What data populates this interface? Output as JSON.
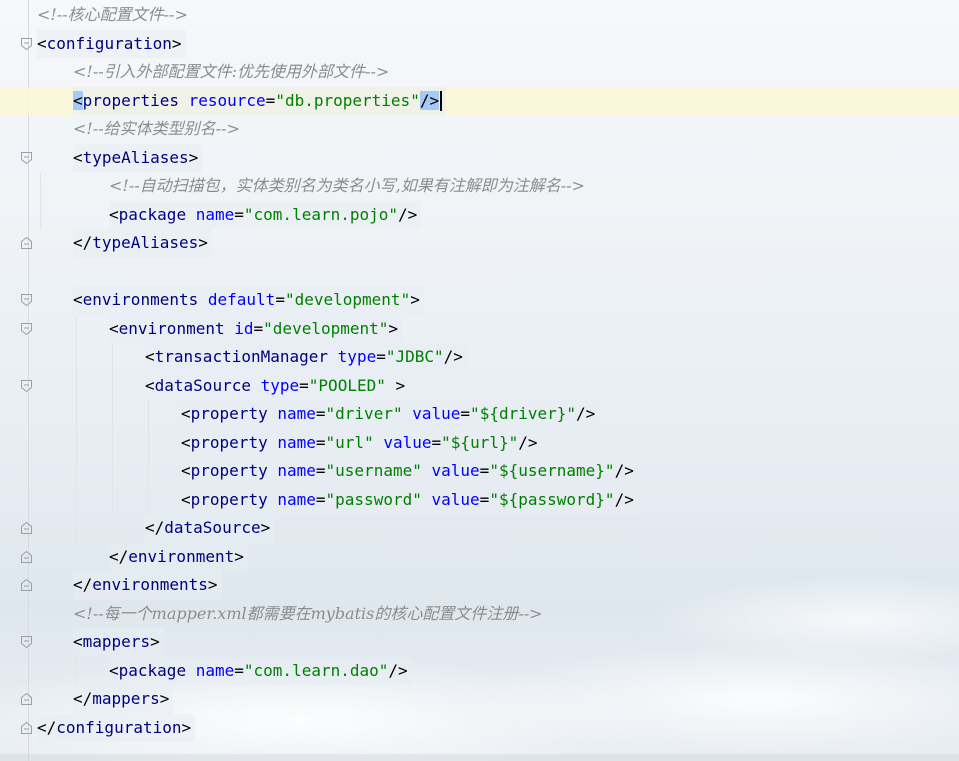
{
  "editor": {
    "lines": [
      {
        "indent": 0,
        "fold": "",
        "comment": "<!--核心配置文件-->"
      },
      {
        "indent": 0,
        "fold": "open",
        "open": "configuration"
      },
      {
        "indent": 1,
        "fold": "",
        "comment": "<!--引入外部配置文件:优先使用外部文件-->"
      },
      {
        "indent": 1,
        "fold": "",
        "current": true,
        "selfclose": "properties",
        "attrs": [
          [
            "resource",
            "db.properties"
          ]
        ]
      },
      {
        "indent": 1,
        "fold": "",
        "comment": "<!--给实体类型别名-->"
      },
      {
        "indent": 1,
        "fold": "open",
        "open": "typeAliases"
      },
      {
        "indent": 2,
        "fold": "",
        "comment": "<!--自动扫描包，实体类别名为类名小写,如果有注解即为注解名-->"
      },
      {
        "indent": 2,
        "fold": "",
        "selfclose": "package",
        "attrs": [
          [
            "name",
            "com.learn.pojo"
          ]
        ]
      },
      {
        "indent": 1,
        "fold": "close",
        "close": "typeAliases"
      },
      {
        "indent": 0,
        "fold": "",
        "blank": true
      },
      {
        "indent": 1,
        "fold": "open",
        "open": "environments",
        "attrs": [
          [
            "default",
            "development"
          ]
        ]
      },
      {
        "indent": 2,
        "fold": "open",
        "open": "environment",
        "attrs": [
          [
            "id",
            "development"
          ]
        ]
      },
      {
        "indent": 3,
        "fold": "",
        "selfclose": "transactionManager",
        "attrs": [
          [
            "type",
            "JDBC"
          ]
        ]
      },
      {
        "indent": 3,
        "fold": "open",
        "open": "dataSource",
        "attrs": [
          [
            "type",
            "POOLED"
          ]
        ],
        "trail": " "
      },
      {
        "indent": 4,
        "fold": "",
        "selfclose": "property",
        "attrs": [
          [
            "name",
            "driver"
          ],
          [
            "value",
            "${driver}"
          ]
        ]
      },
      {
        "indent": 4,
        "fold": "",
        "selfclose": "property",
        "attrs": [
          [
            "name",
            "url"
          ],
          [
            "value",
            "${url}"
          ]
        ]
      },
      {
        "indent": 4,
        "fold": "",
        "selfclose": "property",
        "attrs": [
          [
            "name",
            "username"
          ],
          [
            "value",
            "${username}"
          ]
        ]
      },
      {
        "indent": 4,
        "fold": "",
        "selfclose": "property",
        "attrs": [
          [
            "name",
            "password"
          ],
          [
            "value",
            "${password}"
          ]
        ]
      },
      {
        "indent": 3,
        "fold": "close",
        "close": "dataSource"
      },
      {
        "indent": 2,
        "fold": "close",
        "close": "environment"
      },
      {
        "indent": 1,
        "fold": "close",
        "close": "environments"
      },
      {
        "indent": 1,
        "fold": "",
        "comment": "<!--每一个mapper.xml都需要在mybatis的核心配置文件注册-->"
      },
      {
        "indent": 1,
        "fold": "open",
        "open": "mappers"
      },
      {
        "indent": 2,
        "fold": "",
        "selfclose": "package",
        "attrs": [
          [
            "name",
            "com.learn.dao"
          ]
        ]
      },
      {
        "indent": 1,
        "fold": "close",
        "close": "mappers"
      },
      {
        "indent": 0,
        "fold": "close",
        "close": "configuration"
      }
    ]
  },
  "colors": {
    "tag": "#000080",
    "attribute": "#0000ff",
    "value": "#008000",
    "comment": "#8c8c8c",
    "current_line": "#faf7d6",
    "bracket_match": "#a6c9f5"
  },
  "icons": {
    "fold_open": "fold-expanded-icon",
    "fold_close": "fold-end-icon"
  }
}
